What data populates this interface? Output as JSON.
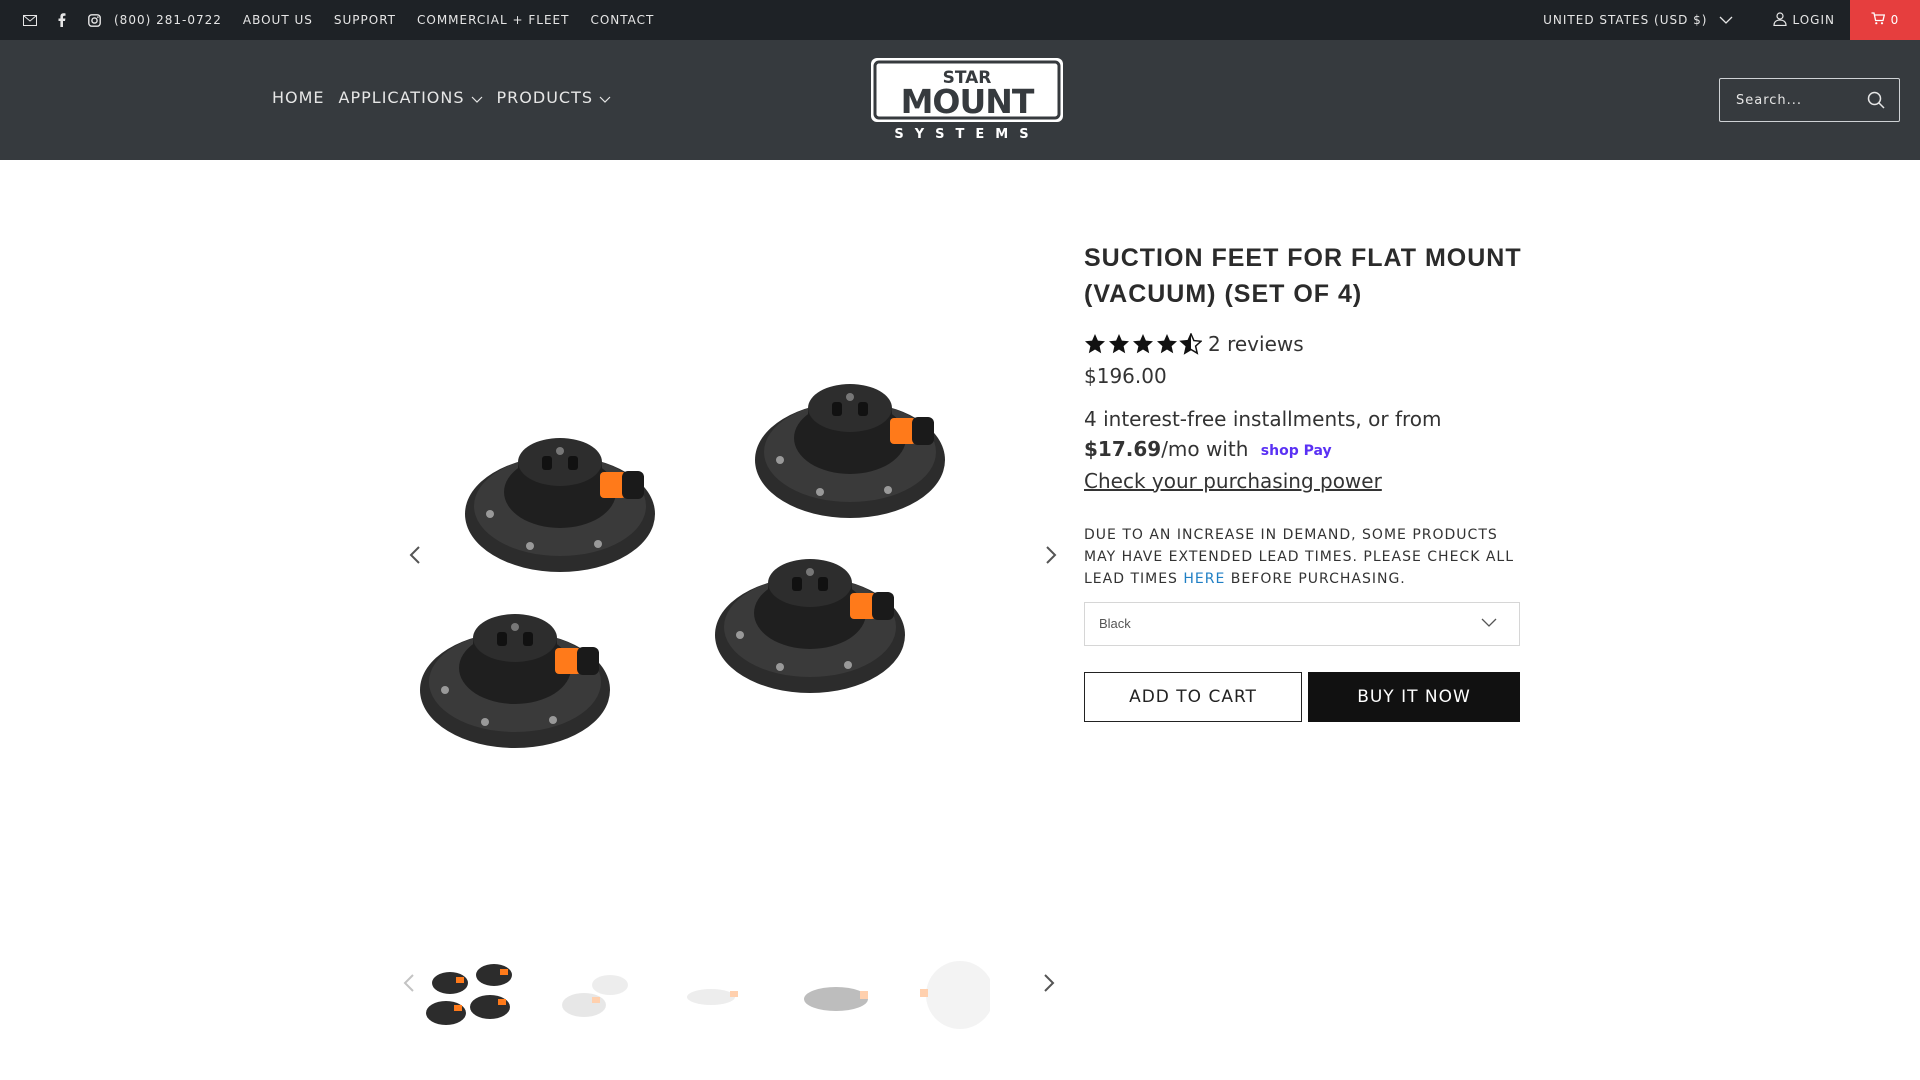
{
  "topbar": {
    "icons": [
      "mail-icon",
      "facebook-icon",
      "instagram-icon"
    ],
    "links": [
      "(800) 281-0722",
      "ABOUT US",
      "SUPPORT",
      "COMMERCIAL + FLEET",
      "CONTACT"
    ],
    "currency": "UNITED STATES (USD $)",
    "login": "LOGIN",
    "cart_count": "0",
    "cart_color": "#e63e3e"
  },
  "header": {
    "nav": [
      {
        "label": "HOME"
      },
      {
        "label": "APPLICATIONS"
      },
      {
        "label": "PRODUCTS"
      }
    ],
    "logo": {
      "line1": "STAR",
      "line2": "MOUNT",
      "line3": "SYSTEMS"
    },
    "search_placeholder": "Search..."
  },
  "product": {
    "title": "SUCTION FEET FOR FLAT MOUNT (VACUUM) (SET OF 4)",
    "rating": 4.5,
    "reviews": "2 reviews",
    "price": "$196.00",
    "installments": {
      "line1": "4 interest-free installments, or from",
      "amount": "$17.69",
      "per": "/mo with",
      "brand": "shop Pay",
      "link": "Check your purchasing power"
    },
    "notice_pre": "DUE TO AN INCREASE IN DEMAND, SOME PRODUCTS MAY HAVE EXTENDED LEAD TIMES. PLEASE CHECK ALL LEAD TIMES ",
    "notice_link": "HERE",
    "notice_post": " BEFORE PURCHASING.",
    "variant": "Black",
    "add_to_cart": "ADD TO CART",
    "buy_now": "BUY IT NOW"
  }
}
